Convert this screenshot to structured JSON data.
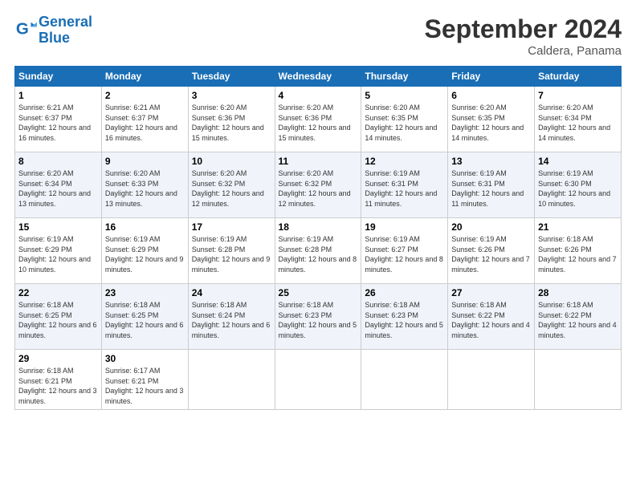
{
  "header": {
    "logo_line1": "General",
    "logo_line2": "Blue",
    "month": "September 2024",
    "location": "Caldera, Panama"
  },
  "weekdays": [
    "Sunday",
    "Monday",
    "Tuesday",
    "Wednesday",
    "Thursday",
    "Friday",
    "Saturday"
  ],
  "weeks": [
    [
      {
        "day": "1",
        "rise": "6:21 AM",
        "set": "6:37 PM",
        "daylight": "12 hours and 16 minutes."
      },
      {
        "day": "2",
        "rise": "6:21 AM",
        "set": "6:37 PM",
        "daylight": "12 hours and 16 minutes."
      },
      {
        "day": "3",
        "rise": "6:20 AM",
        "set": "6:36 PM",
        "daylight": "12 hours and 15 minutes."
      },
      {
        "day": "4",
        "rise": "6:20 AM",
        "set": "6:36 PM",
        "daylight": "12 hours and 15 minutes."
      },
      {
        "day": "5",
        "rise": "6:20 AM",
        "set": "6:35 PM",
        "daylight": "12 hours and 14 minutes."
      },
      {
        "day": "6",
        "rise": "6:20 AM",
        "set": "6:35 PM",
        "daylight": "12 hours and 14 minutes."
      },
      {
        "day": "7",
        "rise": "6:20 AM",
        "set": "6:34 PM",
        "daylight": "12 hours and 14 minutes."
      }
    ],
    [
      {
        "day": "8",
        "rise": "6:20 AM",
        "set": "6:34 PM",
        "daylight": "12 hours and 13 minutes."
      },
      {
        "day": "9",
        "rise": "6:20 AM",
        "set": "6:33 PM",
        "daylight": "12 hours and 13 minutes."
      },
      {
        "day": "10",
        "rise": "6:20 AM",
        "set": "6:32 PM",
        "daylight": "12 hours and 12 minutes."
      },
      {
        "day": "11",
        "rise": "6:20 AM",
        "set": "6:32 PM",
        "daylight": "12 hours and 12 minutes."
      },
      {
        "day": "12",
        "rise": "6:19 AM",
        "set": "6:31 PM",
        "daylight": "12 hours and 11 minutes."
      },
      {
        "day": "13",
        "rise": "6:19 AM",
        "set": "6:31 PM",
        "daylight": "12 hours and 11 minutes."
      },
      {
        "day": "14",
        "rise": "6:19 AM",
        "set": "6:30 PM",
        "daylight": "12 hours and 10 minutes."
      }
    ],
    [
      {
        "day": "15",
        "rise": "6:19 AM",
        "set": "6:29 PM",
        "daylight": "12 hours and 10 minutes."
      },
      {
        "day": "16",
        "rise": "6:19 AM",
        "set": "6:29 PM",
        "daylight": "12 hours and 9 minutes."
      },
      {
        "day": "17",
        "rise": "6:19 AM",
        "set": "6:28 PM",
        "daylight": "12 hours and 9 minutes."
      },
      {
        "day": "18",
        "rise": "6:19 AM",
        "set": "6:28 PM",
        "daylight": "12 hours and 8 minutes."
      },
      {
        "day": "19",
        "rise": "6:19 AM",
        "set": "6:27 PM",
        "daylight": "12 hours and 8 minutes."
      },
      {
        "day": "20",
        "rise": "6:19 AM",
        "set": "6:26 PM",
        "daylight": "12 hours and 7 minutes."
      },
      {
        "day": "21",
        "rise": "6:18 AM",
        "set": "6:26 PM",
        "daylight": "12 hours and 7 minutes."
      }
    ],
    [
      {
        "day": "22",
        "rise": "6:18 AM",
        "set": "6:25 PM",
        "daylight": "12 hours and 6 minutes."
      },
      {
        "day": "23",
        "rise": "6:18 AM",
        "set": "6:25 PM",
        "daylight": "12 hours and 6 minutes."
      },
      {
        "day": "24",
        "rise": "6:18 AM",
        "set": "6:24 PM",
        "daylight": "12 hours and 6 minutes."
      },
      {
        "day": "25",
        "rise": "6:18 AM",
        "set": "6:23 PM",
        "daylight": "12 hours and 5 minutes."
      },
      {
        "day": "26",
        "rise": "6:18 AM",
        "set": "6:23 PM",
        "daylight": "12 hours and 5 minutes."
      },
      {
        "day": "27",
        "rise": "6:18 AM",
        "set": "6:22 PM",
        "daylight": "12 hours and 4 minutes."
      },
      {
        "day": "28",
        "rise": "6:18 AM",
        "set": "6:22 PM",
        "daylight": "12 hours and 4 minutes."
      }
    ],
    [
      {
        "day": "29",
        "rise": "6:18 AM",
        "set": "6:21 PM",
        "daylight": "12 hours and 3 minutes."
      },
      {
        "day": "30",
        "rise": "6:17 AM",
        "set": "6:21 PM",
        "daylight": "12 hours and 3 minutes."
      },
      null,
      null,
      null,
      null,
      null
    ]
  ]
}
